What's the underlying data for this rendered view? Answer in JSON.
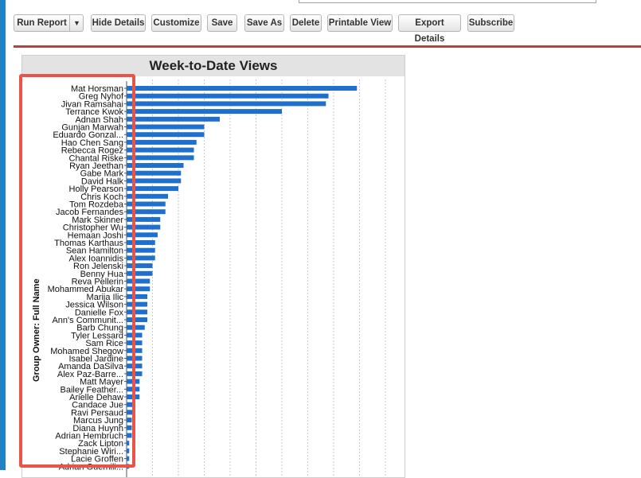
{
  "toolbar": {
    "run_report": "Run Report",
    "dropdown_glyph": "▼",
    "hide_details": "Hide Details",
    "customize": "Customize",
    "save": "Save",
    "save_as": "Save As",
    "delete": "Delete",
    "printable_view": "Printable View",
    "export_details": "Export Details",
    "subscribe": "Subscribe"
  },
  "colors": {
    "bar": "#1f6fce",
    "accent": "#1f84c6",
    "divider": "#b0463f",
    "highlight": "#e8534a"
  },
  "chart_data": {
    "type": "bar",
    "orientation": "horizontal",
    "title": "Week-to-Date Views",
    "ylabel": "Group Owner: Full Name",
    "xlabel": "",
    "grid": true,
    "categories": [
      "Mat Horsman",
      "Greg Nyhof",
      "Jivan Ramsahai",
      "Terrance Kwok",
      "Adnan Shah",
      "Gunjan Marwah",
      "Eduardo Gonzal...",
      "Hao Chen Sang",
      "Rebecca Rogez",
      "Chantal Riske",
      "Ryan Jeethan",
      "Gabe Mark",
      "David Halk",
      "Holly Pearson",
      "Chris Koch",
      "Tom Rozdeba",
      "Jacob Fernandes",
      "Mark Skinner",
      "Christopher Wu",
      "Hemaan Joshi",
      "Thomas Karthaus",
      "Sean Hamilton",
      "Alex Ioannidis",
      "Ron Jelenski",
      "Benny Hua",
      "Reva Pellerin",
      "Mohammed Abukar",
      "Marija Ilic",
      "Jessica Wilson",
      "Danielle Fox",
      "Ann's Communit...",
      "Barb Chung",
      "Tyler Lessard",
      "Sam Rice",
      "Mohamed Shegow",
      "Isabel Jardine",
      "Amanda DaSilva",
      "Alex Paz-Barre...",
      "Matt Mayer",
      "Bailey Feather...",
      "Arielle Dehaw",
      "Candace Jue",
      "Ravi Persaud",
      "Marcus Jung",
      "Diana Huynh",
      "Adrian Hembruch",
      "Zack Lipton",
      "Stephanie Wiri...",
      "Lacie Groffen",
      "Adrian Guemili..."
    ],
    "values": [
      89,
      78,
      77,
      60,
      36,
      30,
      30,
      27,
      26,
      26,
      22,
      21,
      21,
      20,
      16,
      15,
      15,
      13,
      13,
      12,
      11,
      11,
      11,
      10,
      10,
      9,
      9,
      8,
      8,
      8,
      8,
      7,
      6,
      6,
      6,
      6,
      6,
      6,
      5,
      5,
      5,
      3,
      3,
      2,
      2,
      2,
      1,
      1,
      1,
      1
    ]
  }
}
